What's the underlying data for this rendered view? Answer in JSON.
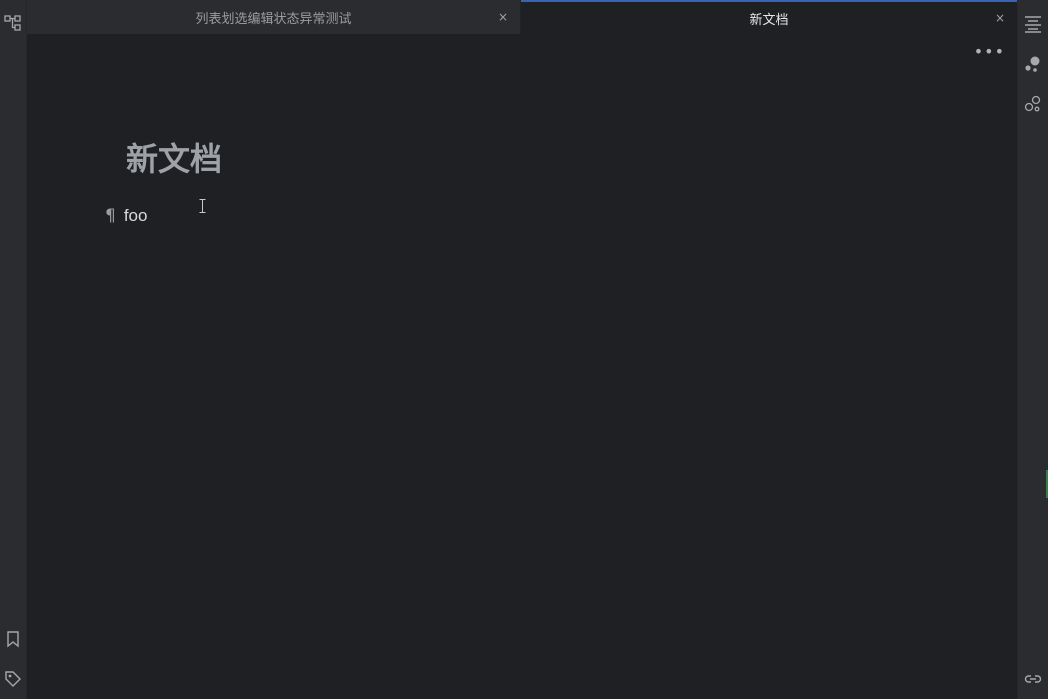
{
  "tabs": [
    {
      "label": "列表划选编辑状态异常测试",
      "active": false,
      "close_glyph": "×"
    },
    {
      "label": "新文档",
      "active": true,
      "close_glyph": "×"
    }
  ],
  "editor": {
    "more_glyph": "•••",
    "title": "新文档",
    "paragraphs": [
      {
        "mark": "¶",
        "text": "foo"
      }
    ]
  },
  "left_rail": {
    "icons": [
      "outline-tree-icon",
      "bookmark-icon",
      "tag-icon"
    ]
  },
  "right_rail": {
    "icons": [
      "outline-list-icon",
      "graph-icon",
      "global-graph-icon",
      "link-icon"
    ]
  },
  "colors": {
    "background": "#1f2023",
    "rail": "#2b2c2f",
    "active_tab_indicator": "#3a63b0",
    "title": "#9ea1a6"
  }
}
